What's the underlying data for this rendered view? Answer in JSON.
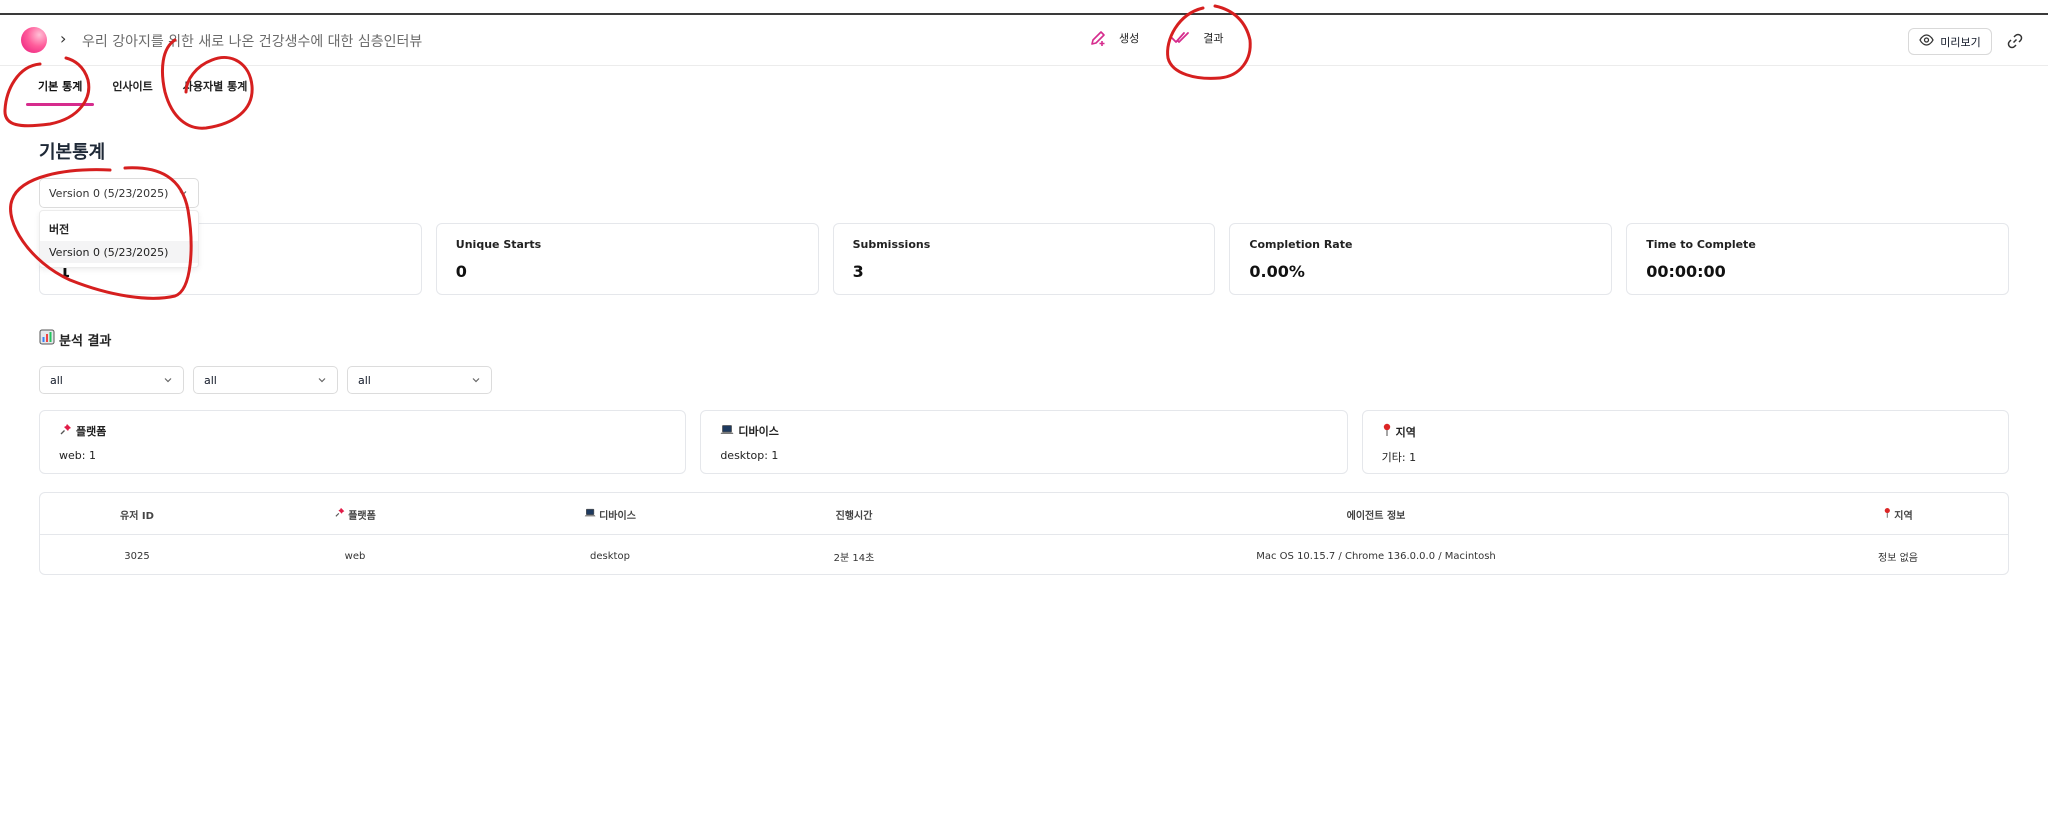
{
  "header": {
    "title": "우리 강아지를 위한 새로 나온 건강생수에 대한 심층인터뷰",
    "nav": [
      {
        "label": "생성",
        "icon": "pen-plus-icon"
      },
      {
        "label": "결과",
        "icon": "double-check-icon"
      }
    ],
    "preview_label": "미리보기",
    "accent": "#d62c8d"
  },
  "tabs": [
    {
      "label": "기본 통계",
      "active": true
    },
    {
      "label": "인사이트",
      "active": false
    },
    {
      "label": "사용자별 통계",
      "active": false
    }
  ],
  "section_title": "기본통계",
  "version_select": {
    "value": "Version 0 (5/23/2025)",
    "dropdown_header": "버전",
    "options": [
      "Version 0 (5/23/2025)"
    ]
  },
  "stats": [
    {
      "label": "",
      "value": "1"
    },
    {
      "label": "Unique Starts",
      "value": "0"
    },
    {
      "label": "Submissions",
      "value": "3"
    },
    {
      "label": "Completion Rate",
      "value": "0.00%"
    },
    {
      "label": "Time to Complete",
      "value": "00:00:00"
    }
  ],
  "analysis": {
    "title": "분석 결과",
    "filters": [
      "all",
      "all",
      "all"
    ],
    "summaries": [
      {
        "label": "플랫폼",
        "value": "web: 1",
        "icon": "pushpin-icon"
      },
      {
        "label": "디바이스",
        "value": "desktop: 1",
        "icon": "laptop-icon"
      },
      {
        "label": "지역",
        "value": "기타: 1",
        "icon": "round-pin-icon"
      }
    ]
  },
  "table": {
    "headers": [
      "유저 ID",
      "플랫폼",
      "디바이스",
      "진행시간",
      "에이전트 정보",
      "지역"
    ],
    "rows": [
      [
        "3025",
        "web",
        "desktop",
        "2분 14초",
        "Mac OS 10.15.7 / Chrome 136.0.0.0 / Macintosh",
        "정보 없음"
      ]
    ]
  }
}
